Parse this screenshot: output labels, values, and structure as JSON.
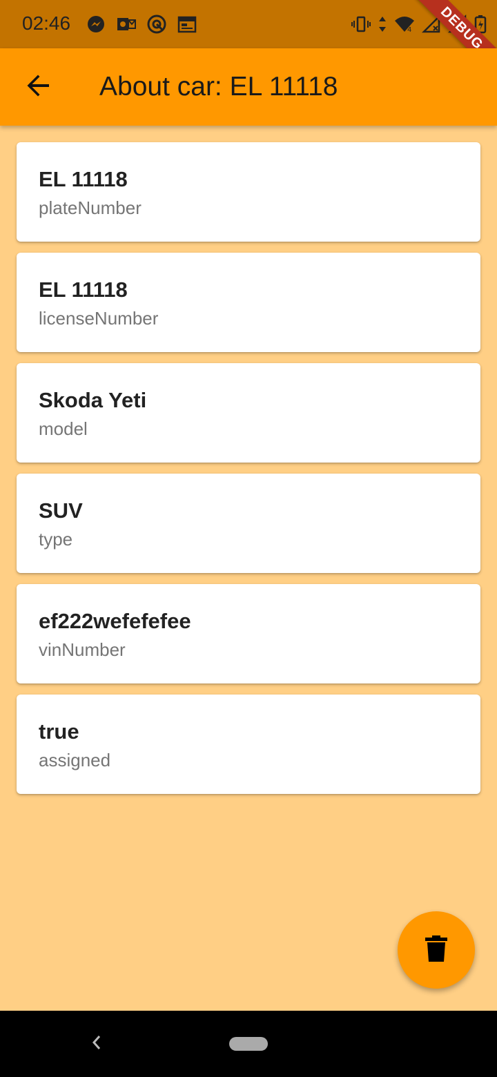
{
  "status_bar": {
    "time": "02:46",
    "left_icons": [
      "messenger-icon",
      "outlook-icon",
      "vpn-icon",
      "calendar-icon"
    ],
    "right_icons": [
      "vibrate-icon",
      "data-arrows-icon",
      "wifi-icon",
      "signal-icon",
      "signal-icon",
      "battery-icon"
    ],
    "debug_label": "DEBUG"
  },
  "app_bar": {
    "title": "About car: EL 11118",
    "back_icon": "arrow-left-icon"
  },
  "details": [
    {
      "value": "EL 11118",
      "label": "plateNumber"
    },
    {
      "value": "EL 11118",
      "label": "licenseNumber"
    },
    {
      "value": "Skoda Yeti",
      "label": "model"
    },
    {
      "value": "SUV",
      "label": "type"
    },
    {
      "value": "ef222wefefefee",
      "label": "vinNumber"
    },
    {
      "value": "true",
      "label": "assigned"
    }
  ],
  "fab": {
    "icon": "trash-icon"
  },
  "colors": {
    "status_bar": "#C37300",
    "app_bar": "#FF9800",
    "background": "#FFCF85",
    "card": "#FFFFFF",
    "debug_ribbon": "#B7301E"
  }
}
